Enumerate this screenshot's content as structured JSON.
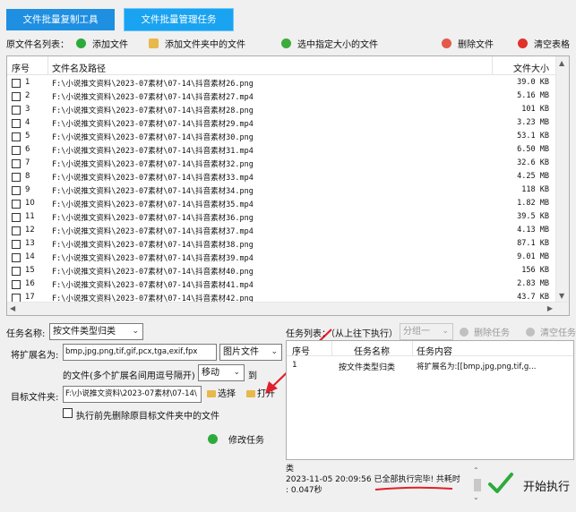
{
  "tabs": [
    {
      "label": "文件批量复制工具"
    },
    {
      "label": "文件批量管理任务"
    }
  ],
  "toolbar": {
    "list_label": "原文件名列表：",
    "add_file": "添加文件",
    "add_folder_files": "添加文件夹中的文件",
    "select_size": "选中指定大小的文件",
    "delete_file": "删除文件",
    "clear_table": "清空表格"
  },
  "colors": {
    "tab_bg": "#1e8fe1",
    "add_icon": "#2eaa3c",
    "folder_icon": "#e8b84a",
    "select_icon": "#3cab3c",
    "delete_icon": "#e45a4a",
    "clear_icon": "#e0322a",
    "annotation_red": "#e0202a"
  },
  "file_table": {
    "headers": {
      "index": "序号",
      "path": "文件名及路径",
      "size": "文件大小"
    },
    "rows": [
      {
        "n": "1",
        "path": "F:\\小说推文资料\\2023-07素材\\07-14\\抖音素材26.png",
        "size": "39.0 KB"
      },
      {
        "n": "2",
        "path": "F:\\小说推文资料\\2023-07素材\\07-14\\抖音素材27.mp4",
        "size": "5.16 MB"
      },
      {
        "n": "3",
        "path": "F:\\小说推文资料\\2023-07素材\\07-14\\抖音素材28.png",
        "size": "101 KB"
      },
      {
        "n": "4",
        "path": "F:\\小说推文资料\\2023-07素材\\07-14\\抖音素材29.mp4",
        "size": "3.23 MB"
      },
      {
        "n": "5",
        "path": "F:\\小说推文资料\\2023-07素材\\07-14\\抖音素材30.png",
        "size": "53.1 KB"
      },
      {
        "n": "6",
        "path": "F:\\小说推文资料\\2023-07素材\\07-14\\抖音素材31.mp4",
        "size": "6.50 MB"
      },
      {
        "n": "7",
        "path": "F:\\小说推文资料\\2023-07素材\\07-14\\抖音素材32.png",
        "size": "32.6 KB"
      },
      {
        "n": "8",
        "path": "F:\\小说推文资料\\2023-07素材\\07-14\\抖音素材33.mp4",
        "size": "4.25 MB"
      },
      {
        "n": "9",
        "path": "F:\\小说推文资料\\2023-07素材\\07-14\\抖音素材34.png",
        "size": "118 KB"
      },
      {
        "n": "10",
        "path": "F:\\小说推文资料\\2023-07素材\\07-14\\抖音素材35.mp4",
        "size": "1.82 MB"
      },
      {
        "n": "11",
        "path": "F:\\小说推文资料\\2023-07素材\\07-14\\抖音素材36.png",
        "size": "39.5 KB"
      },
      {
        "n": "12",
        "path": "F:\\小说推文资料\\2023-07素材\\07-14\\抖音素材37.mp4",
        "size": "4.13 MB"
      },
      {
        "n": "13",
        "path": "F:\\小说推文资料\\2023-07素材\\07-14\\抖音素材38.png",
        "size": "87.1 KB"
      },
      {
        "n": "14",
        "path": "F:\\小说推文资料\\2023-07素材\\07-14\\抖音素材39.mp4",
        "size": "9.01 MB"
      },
      {
        "n": "15",
        "path": "F:\\小说推文资料\\2023-07素材\\07-14\\抖音素材40.png",
        "size": "156 KB"
      },
      {
        "n": "16",
        "path": "F:\\小说推文资料\\2023-07素材\\07-14\\抖音素材41.mp4",
        "size": "2.83 MB"
      },
      {
        "n": "17",
        "path": "F:\\小说推文资料\\2023-07素材\\07-14\\抖音素材42.png",
        "size": "43.7 KB"
      }
    ]
  },
  "task_form": {
    "task_name_label": "任务名称:",
    "task_name_value": "按文件类型归类",
    "ext_label": "将扩展名为:",
    "ext_value": "bmp,jpg,png,tif,gif,pcx,tga,exif,fpx",
    "ext_type_value": "图片文件",
    "desc_label": "的文件(多个扩展名间用逗号隔开)",
    "action_value": "移动",
    "to_label": "到",
    "target_label": "目标文件夹:",
    "target_value": "F:\\小说推文资料\\2023-07素材\\07-14\\",
    "choose_button": "选择",
    "open_button": "打开",
    "delete_checkbox_label": "执行前先删除原目标文件夹中的文件",
    "modify_button": "修改任务"
  },
  "task_list": {
    "label": "任务列表：（从上往下执行）",
    "group_value": "分组一",
    "delete_task": "删除任务",
    "clear_task": "清空任务",
    "headers": {
      "index": "序号",
      "name": "任务名称",
      "content": "任务内容"
    },
    "rows": [
      {
        "n": "1",
        "name": "按文件类型归类",
        "content": "将扩展名为:[[bmp,jpg,png,tif,g..."
      }
    ]
  },
  "log": {
    "line0": "类",
    "line1": "2023-11-05 20:09:56 已全部执行完毕! 共耗时",
    "line2": ": 0.047秒"
  },
  "start_button": "开始执行"
}
